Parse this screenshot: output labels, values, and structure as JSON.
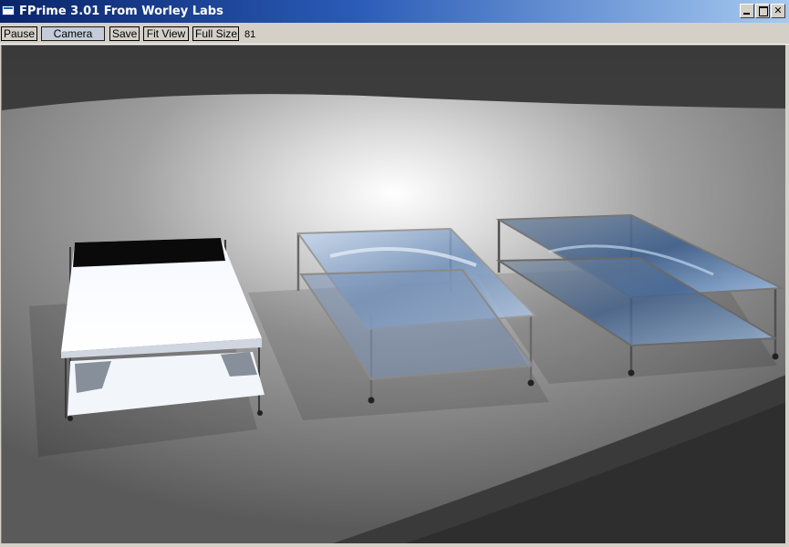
{
  "window": {
    "title": "FPrime 3.01 From Worley Labs",
    "minimize_symbol": "",
    "maximize_symbol": "",
    "close_symbol": "✕"
  },
  "toolbar": {
    "pause_label": "Pause",
    "camera_label": "Camera",
    "save_label": "Save",
    "fit_view_label": "Fit View",
    "full_size_label": "Full Size",
    "frame_count": "81"
  },
  "icons": {
    "app": "application-window-icon",
    "minimize": "minimize-icon",
    "maximize": "maximize-icon",
    "close": "close-icon"
  },
  "colors": {
    "title_gradient_start": "#0a246a",
    "title_gradient_end": "#a6caf0",
    "chrome": "#d4d0c8",
    "glass_tint": "#8fb4e0"
  }
}
